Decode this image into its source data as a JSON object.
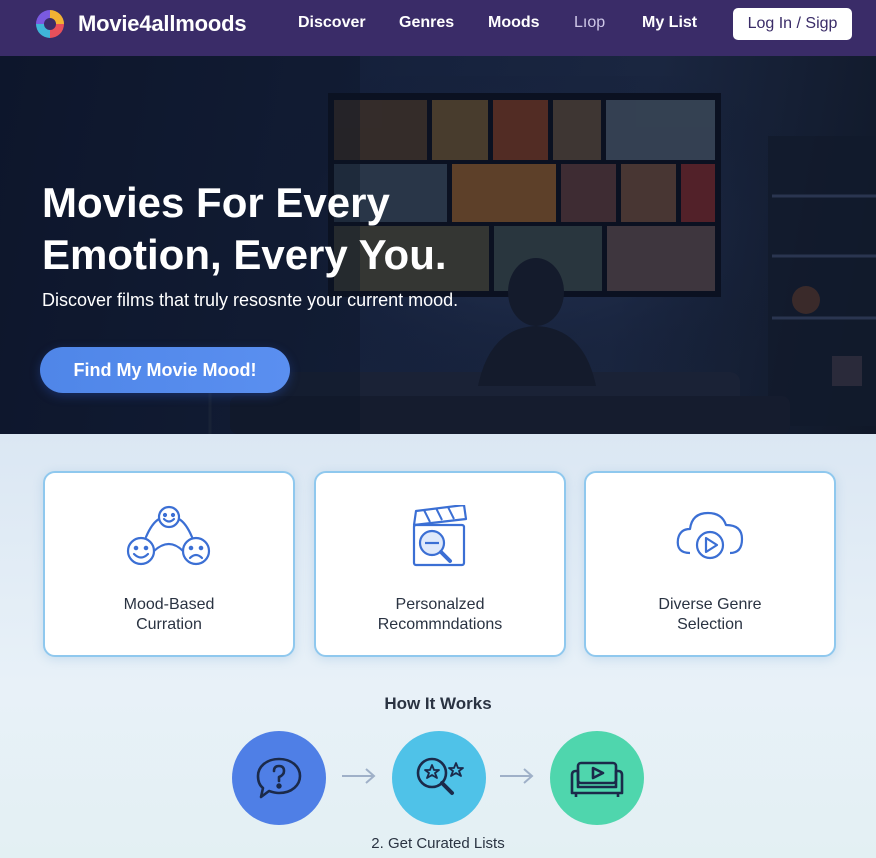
{
  "brand": {
    "name": "Movie4allmoods",
    "logo_icon": "swirl-logo-icon"
  },
  "nav": {
    "links": [
      "Discover",
      "Genres",
      "Moods",
      "Lıop",
      "My List"
    ],
    "login_label": "Log In / Sigp"
  },
  "hero": {
    "title": "Movies For Every Emotion, Every You.",
    "subtitle": "Discover films that truly resosnte your current mood.",
    "cta_label": "Find My Movie Mood!"
  },
  "features": [
    {
      "label": "Mood-Based\nCurration",
      "icon": "mood-faces-icon"
    },
    {
      "label": "Personalzed\nRecommndations",
      "icon": "clapperboard-search-icon"
    },
    {
      "label": "Diverse Genre\nSelection",
      "icon": "cloud-play-icon"
    }
  ],
  "how_it_works": {
    "title": "How It Works",
    "steps": [
      {
        "icon": "question-bubble-icon",
        "color": "#4f7fe6"
      },
      {
        "icon": "search-stars-icon",
        "color": "#4fc2e8"
      },
      {
        "icon": "couch-play-icon",
        "color": "#4fd6ad"
      }
    ],
    "active_caption": "2. Get Curated Lists"
  },
  "colors": {
    "nav_bg": "#3a2c68",
    "accent": "#5a8ff0",
    "card_border": "#8fc8ee",
    "icon_blue": "#3b6fd4"
  }
}
